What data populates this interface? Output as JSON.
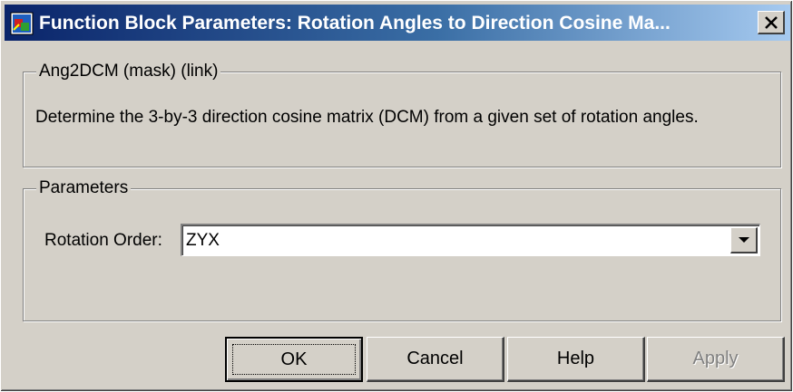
{
  "window": {
    "title": "Function Block Parameters: Rotation Angles to Direction Cosine Ma...",
    "app_icon": "simulink-block-icon",
    "close_icon": "close-x-icon"
  },
  "description_group": {
    "legend": "Ang2DCM (mask) (link)",
    "text": "Determine the 3-by-3 direction cosine matrix (DCM) from a given set of rotation angles."
  },
  "parameters_group": {
    "legend": "Parameters",
    "rotation_order": {
      "label": "Rotation Order:",
      "value": "ZYX"
    }
  },
  "buttons": {
    "ok": "OK",
    "cancel": "Cancel",
    "help": "Help",
    "apply": "Apply"
  },
  "colors": {
    "dialog_bg": "#d4d0c8",
    "title_bar_start": "#0a246a",
    "title_bar_end": "#a6caf0",
    "disabled_text": "#808080"
  }
}
